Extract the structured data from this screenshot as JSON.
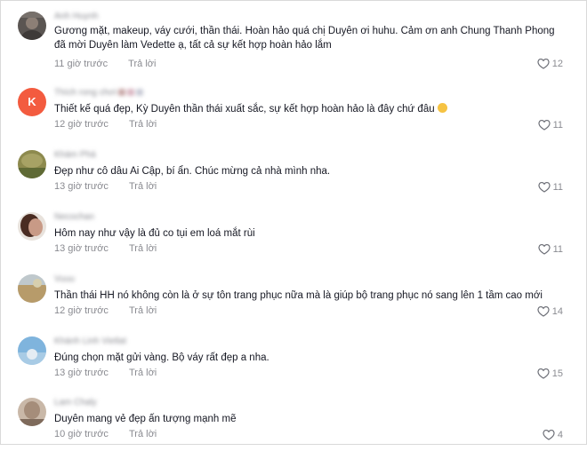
{
  "comments": [
    {
      "username": "Anh Huynh",
      "text": "Gương mặt, makeup, váy cưới, thần thái. Hoàn hảo quá chị Duyên ơi huhu. Cảm ơn anh Chung Thanh Phong đã mời Duyên làm Vedette ạ, tất cả sự kết hợp hoàn hảo lắm",
      "time": "11 giờ trước",
      "reply": "Trả lời",
      "likes": "12"
    },
    {
      "username": "Thích rong chơi",
      "avatar_letter": "K",
      "text": "Thiết kế quá đẹp, Kỳ Duyên thần thái xuất sắc, sự kết hợp hoàn hảo là đây chứ đâu",
      "time": "12 giờ trước",
      "reply": "Trả lời",
      "likes": "11"
    },
    {
      "username": "Khám Phá",
      "text": "Đẹp như cô dâu Ai Cập, bí ẩn. Chúc mừng cả nhà mình nha.",
      "time": "13 giờ trước",
      "reply": "Trả lời",
      "likes": "11"
    },
    {
      "username": "Necochan",
      "text": "Hôm nay như vậy là đủ co tụi em loá mắt rùi",
      "time": "13 giờ trước",
      "reply": "Trả lời",
      "likes": "11"
    },
    {
      "username": "Vuuu",
      "text": "Thần thái HH nó không còn là ở sự tôn trang phục nữa mà là giúp bộ trang phục nó sang lên 1 tầm cao mới",
      "time": "12 giờ trước",
      "reply": "Trả lời",
      "likes": "14"
    },
    {
      "username": "Khánh Linh Vietlat",
      "text": "Đúng chọn mặt gửi vàng. Bộ váy rất đẹp a nha.",
      "time": "13 giờ trước",
      "reply": "Trả lời",
      "likes": "15"
    },
    {
      "username": "Lam Chaly",
      "text": "Duyên mang vẻ đẹp ấn tượng mạnh mẽ",
      "time": "10 giờ trước",
      "reply": "Trả lời",
      "likes": "4"
    }
  ]
}
